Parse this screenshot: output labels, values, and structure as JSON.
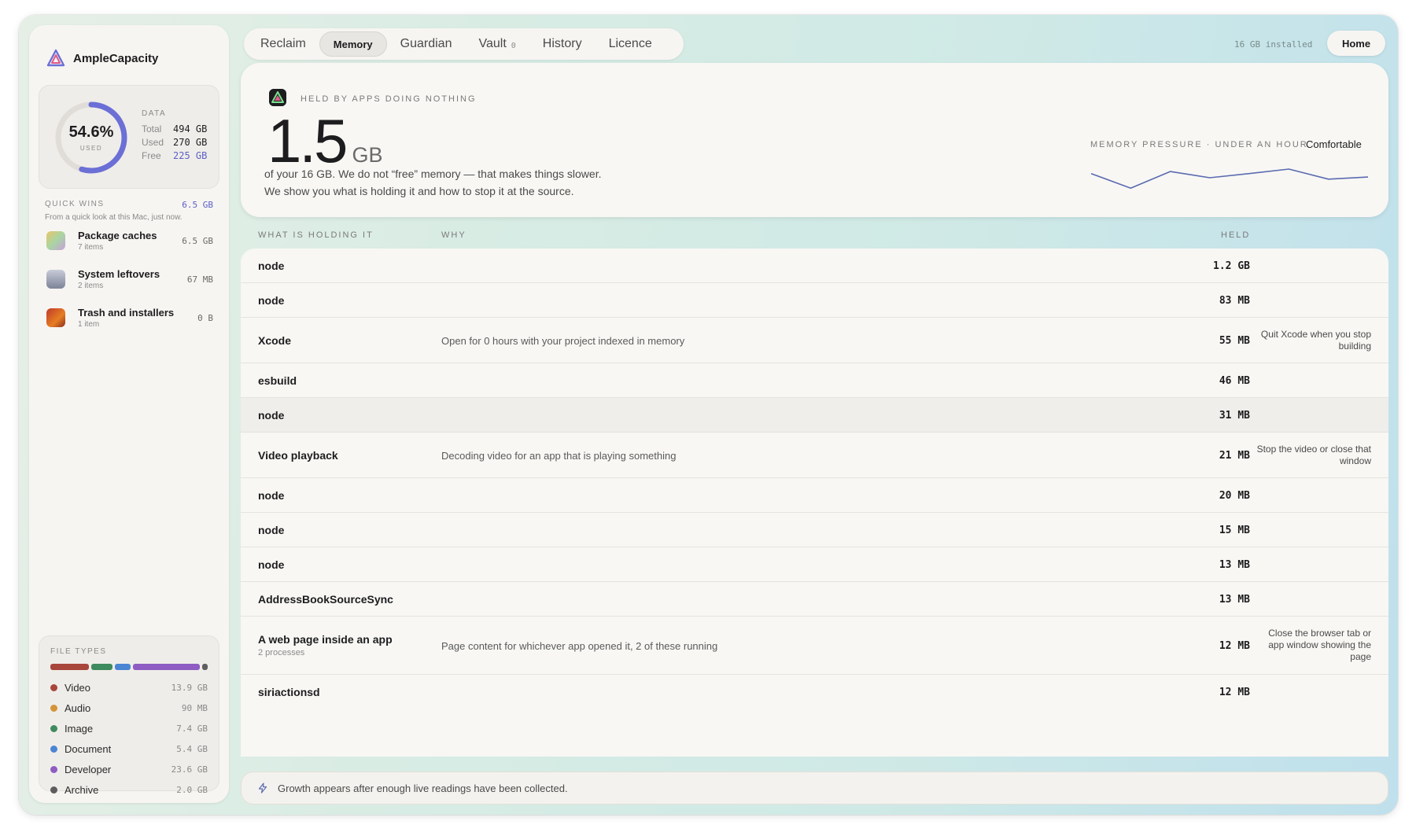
{
  "app": {
    "name": "AmpleCapacity"
  },
  "disk": {
    "percent_label": "54.6%",
    "percent_value": 54.6,
    "used_caption": "USED",
    "stats_header": "DATA",
    "stats": [
      {
        "label": "Total",
        "value": "494 GB"
      },
      {
        "label": "Used",
        "value": "270 GB"
      },
      {
        "label": "Free",
        "value": "225 GB"
      }
    ]
  },
  "quick_wins": {
    "title": "QUICK WINS",
    "total": "6.5 GB",
    "subtitle": "From a quick look at this Mac, just now.",
    "items": [
      {
        "name": "Package caches",
        "count": "7 items",
        "size": "6.5 GB",
        "icon": "package-icon"
      },
      {
        "name": "System leftovers",
        "count": "2 items",
        "size": "67 MB",
        "icon": "drive-icon"
      },
      {
        "name": "Trash and installers",
        "count": "1 item",
        "size": "0 B",
        "icon": "trash-icon"
      }
    ]
  },
  "file_types": {
    "title": "FILE TYPES",
    "items": [
      {
        "name": "Video",
        "size": "13.9 GB",
        "color": "#a8463c"
      },
      {
        "name": "Audio",
        "size": "90 MB",
        "color": "#d4943a"
      },
      {
        "name": "Image",
        "size": "7.4 GB",
        "color": "#3f8a5e"
      },
      {
        "name": "Document",
        "size": "5.4 GB",
        "color": "#4a86d4"
      },
      {
        "name": "Developer",
        "size": "23.6 GB",
        "color": "#8e5cc2"
      },
      {
        "name": "Archive",
        "size": "2.0 GB",
        "color": "#5e5e5e"
      }
    ]
  },
  "tabs": [
    {
      "label": "Reclaim",
      "active": false
    },
    {
      "label": "Memory",
      "active": true
    },
    {
      "label": "Guardian",
      "active": false
    },
    {
      "label": "Vault",
      "active": false,
      "badge": "0"
    },
    {
      "label": "History",
      "active": false
    },
    {
      "label": "Licence",
      "active": false
    }
  ],
  "header": {
    "installed": "16 GB installed",
    "home_label": "Home"
  },
  "hero": {
    "label": "HELD BY APPS DOING NOTHING",
    "value": "1.5",
    "unit": "GB",
    "desc_line1": "of your 16 GB. We do not “free” memory — that makes things slower.",
    "desc_line2": "We show you what is holding it and how to stop it at the source.",
    "pressure_label": "MEMORY PRESSURE · UNDER AN HOUR",
    "pressure_status": "Comfortable",
    "pressure_series": [
      0.62,
      0.2,
      0.68,
      0.5,
      0.62,
      0.75,
      0.46,
      0.52
    ]
  },
  "table": {
    "col_what": "WHAT IS HOLDING IT",
    "col_why": "WHY",
    "col_held": "HELD",
    "rows": [
      {
        "name": "node",
        "sub": "",
        "why": "",
        "held": "1.2 GB",
        "fix": ""
      },
      {
        "name": "node",
        "sub": "",
        "why": "",
        "held": "83 MB",
        "fix": ""
      },
      {
        "name": "Xcode",
        "sub": "",
        "why": "Open for 0 hours with your project indexed in memory",
        "held": "55 MB",
        "fix": "Quit Xcode when you stop building"
      },
      {
        "name": "esbuild",
        "sub": "",
        "why": "",
        "held": "46 MB",
        "fix": ""
      },
      {
        "name": "node",
        "sub": "",
        "why": "",
        "held": "31 MB",
        "fix": ""
      },
      {
        "name": "Video playback",
        "sub": "",
        "why": "Decoding video for an app that is playing something",
        "held": "21 MB",
        "fix": "Stop the video or close that window"
      },
      {
        "name": "node",
        "sub": "",
        "why": "",
        "held": "20 MB",
        "fix": ""
      },
      {
        "name": "node",
        "sub": "",
        "why": "",
        "held": "15 MB",
        "fix": ""
      },
      {
        "name": "node",
        "sub": "",
        "why": "",
        "held": "13 MB",
        "fix": ""
      },
      {
        "name": "AddressBookSourceSync",
        "sub": "",
        "why": "",
        "held": "13 MB",
        "fix": ""
      },
      {
        "name": "A web page inside an app",
        "sub": "2 processes",
        "why": "Page content for whichever app opened it, 2 of these running",
        "held": "12 MB",
        "fix": "Close the browser tab or app window showing the page"
      },
      {
        "name": "siriactionsd",
        "sub": "",
        "why": "",
        "held": "12 MB",
        "fix": ""
      }
    ]
  },
  "footer": {
    "text": "Growth appears after enough live readings have been collected."
  }
}
